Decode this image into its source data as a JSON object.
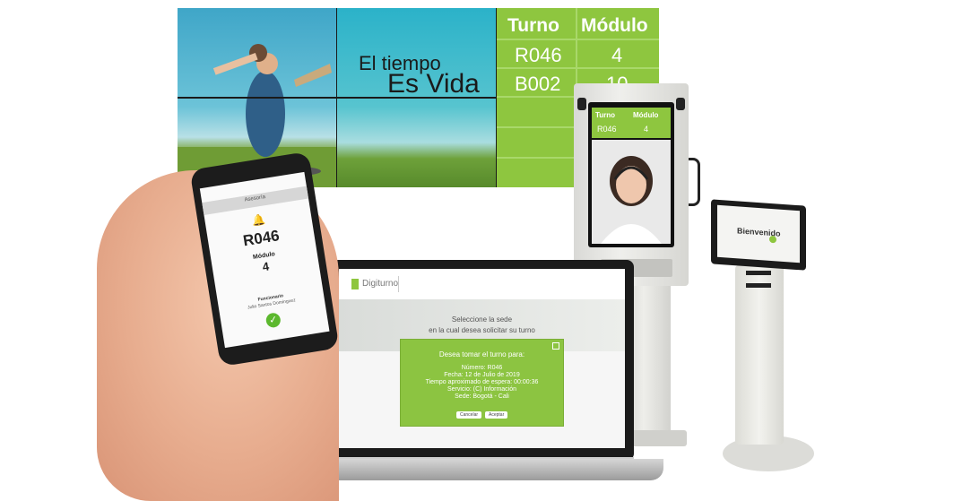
{
  "video_wall": {
    "slogan_line1": "El tiempo",
    "slogan_line2": "Es Vida",
    "table": {
      "headers": [
        "Turno",
        "Módulo"
      ],
      "rows": [
        [
          "R046",
          "4"
        ],
        [
          "B002",
          "10"
        ]
      ]
    }
  },
  "tall_kiosk": {
    "headers": [
      "Turno",
      "Módulo"
    ],
    "row": [
      "R046",
      "4"
    ]
  },
  "small_kiosk": {
    "title": "Bienvenido"
  },
  "laptop": {
    "brand": "Digiturno",
    "hero_line1": "Seleccione la sede",
    "hero_line2": "en la cual desea solicitar su turno",
    "dialog": {
      "title": "Desea tomar el turno para:",
      "numero": "Número: R046",
      "fecha": "Fecha: 12 de Julio de 2019",
      "tiempo": "Tiempo aproximado de espera: 00:00:36",
      "servicio": "Servicio: (C) Información",
      "sede": "Sede: Bogotá - Cali",
      "cancel": "Cancelar",
      "accept": "Aceptar"
    }
  },
  "phone": {
    "section": "Asesoría",
    "turno": "R046",
    "modulo_label": "Módulo",
    "modulo_value": "4",
    "funcionario_label": "Funcionario",
    "funcionario_name": "Julio Santos Domínguez"
  },
  "colors": {
    "accent_green": "#8ec63f"
  }
}
